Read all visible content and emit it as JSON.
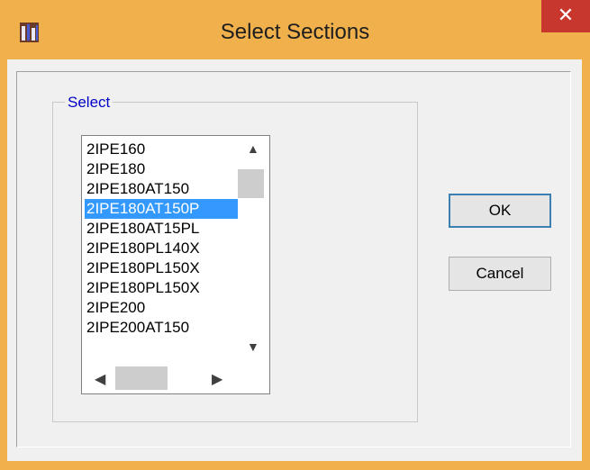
{
  "window": {
    "title": "Select Sections",
    "close_label": "✕"
  },
  "group": {
    "label": "Select"
  },
  "list": {
    "items": [
      "2IPE160",
      "2IPE180",
      "2IPE180AT150",
      "2IPE180AT150P",
      "2IPE180AT15PL",
      "2IPE180PL140X",
      "2IPE180PL150X",
      "2IPE180PL150X",
      "2IPE200",
      "2IPE200AT150"
    ],
    "selected_index": 3
  },
  "buttons": {
    "ok_label": "OK",
    "cancel_label": "Cancel"
  },
  "colors": {
    "titlebar": "#f0b14d",
    "close": "#c7372d",
    "selection": "#3399ff"
  }
}
